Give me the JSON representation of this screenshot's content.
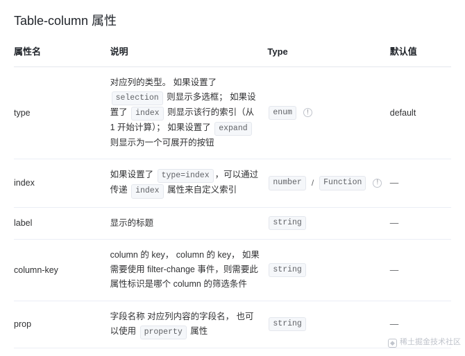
{
  "title": "Table-column 属性",
  "headers": {
    "name": "属性名",
    "desc": "说明",
    "type": "Type",
    "default": "默认值"
  },
  "rows": [
    {
      "name": "type",
      "desc_parts": [
        {
          "t": "text",
          "v": "对应列的类型。 如果设置了 "
        },
        {
          "t": "code",
          "v": "selection"
        },
        {
          "t": "text",
          "v": " 则显示多选框； 如果设置了 "
        },
        {
          "t": "code",
          "v": "index"
        },
        {
          "t": "text",
          "v": " 则显示该行的索引（从 1 开始计算）； 如果设置了 "
        },
        {
          "t": "code",
          "v": "expand"
        },
        {
          "t": "text",
          "v": " 则显示为一个可展开的按钮"
        }
      ],
      "types": [
        "enum"
      ],
      "info": true,
      "default": "default",
      "default_is_dash": false
    },
    {
      "name": "index",
      "desc_parts": [
        {
          "t": "text",
          "v": "如果设置了 "
        },
        {
          "t": "code",
          "v": "type=index"
        },
        {
          "t": "text",
          "v": "，可以通过传递 "
        },
        {
          "t": "code",
          "v": "index"
        },
        {
          "t": "text",
          "v": " 属性来自定义索引"
        }
      ],
      "types": [
        "number",
        "Function"
      ],
      "info": true,
      "default": "—",
      "default_is_dash": true
    },
    {
      "name": "label",
      "desc_parts": [
        {
          "t": "text",
          "v": "显示的标题"
        }
      ],
      "types": [
        "string"
      ],
      "info": false,
      "default": "—",
      "default_is_dash": true
    },
    {
      "name": "column-key",
      "desc_parts": [
        {
          "t": "text",
          "v": "column 的 key， column 的 key， 如果需要使用 filter-change 事件，则需要此属性标识是哪个 column 的筛选条件"
        }
      ],
      "types": [
        "string"
      ],
      "info": false,
      "default": "—",
      "default_is_dash": true
    },
    {
      "name": "prop",
      "desc_parts": [
        {
          "t": "text",
          "v": "字段名称 对应列内容的字段名， 也可以使用 "
        },
        {
          "t": "code",
          "v": "property"
        },
        {
          "t": "text",
          "v": " 属性"
        }
      ],
      "types": [
        "string"
      ],
      "info": false,
      "default": "—",
      "default_is_dash": true
    }
  ],
  "watermark": "稀土掘金技术社区"
}
